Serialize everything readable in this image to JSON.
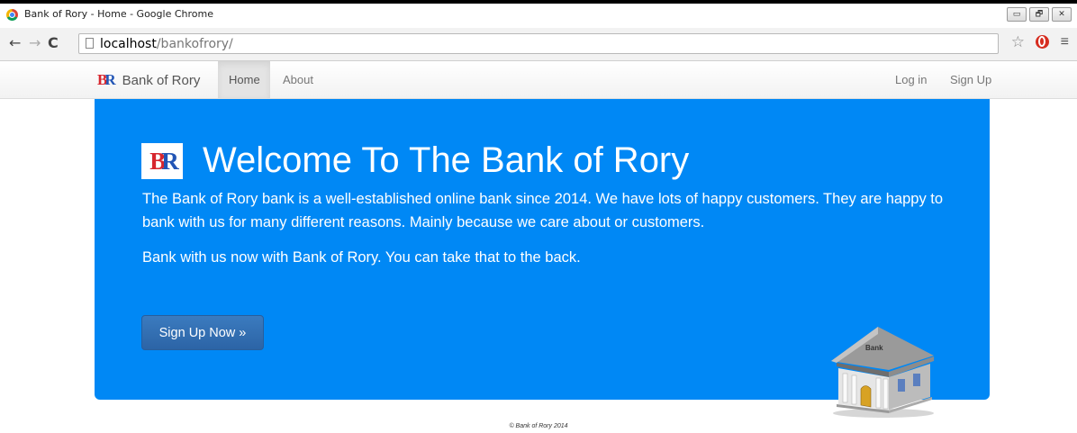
{
  "window": {
    "title": "Bank of Rory - Home - Google Chrome",
    "buttons": [
      "▭",
      "🗗",
      "✕"
    ]
  },
  "browser": {
    "url_host": "localhost",
    "url_path": "/bankofrory/",
    "back_glyph": "←",
    "forward_glyph": "→",
    "reload_glyph": "C",
    "star_glyph": "☆",
    "menu_glyph": "≡"
  },
  "navbar": {
    "brand_logo_b": "B",
    "brand_logo_r": "R",
    "brand_name": "Bank of Rory",
    "links": {
      "home": "Home",
      "about": "About",
      "login": "Log in",
      "signup": "Sign Up"
    }
  },
  "jumbotron": {
    "logo_b": "B",
    "logo_r": "R",
    "title": "Welcome To The Bank of Rory",
    "paragraph1": "The Bank of Rory bank is a well-established online bank since 2014. We have lots of happy customers. They are happy to bank with us for many different reasons. Mainly because we care about or customers.",
    "paragraph2": "Bank with us now with Bank of Rory. You can take that to the back.",
    "cta_label": "Sign Up Now »",
    "bank_sign": "Bank"
  },
  "footer": {
    "text": "© Bank of Rory 2014"
  },
  "colors": {
    "jumbotron_bg": "#0088f5",
    "cta_bg": "#3b7bbf",
    "logo_red": "#d7262e",
    "logo_blue": "#2255b5"
  }
}
